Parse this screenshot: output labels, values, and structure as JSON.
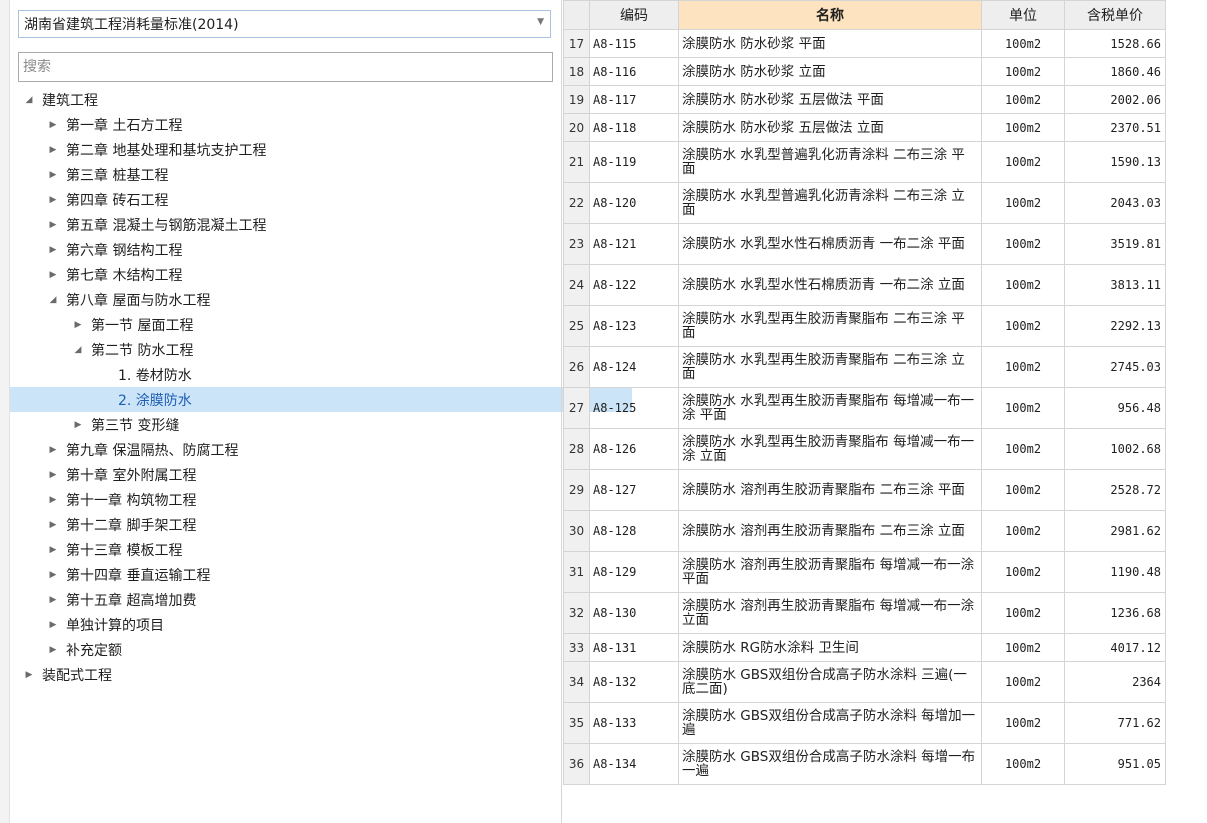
{
  "selector": {
    "value": "湖南省建筑工程消耗量标准(2014)"
  },
  "search": {
    "placeholder": "搜索"
  },
  "tree": [
    {
      "label": "建筑工程",
      "level": 0,
      "toggle": "open"
    },
    {
      "label": "第一章 土石方工程",
      "level": 1,
      "toggle": "closed"
    },
    {
      "label": "第二章 地基处理和基坑支护工程",
      "level": 1,
      "toggle": "closed"
    },
    {
      "label": "第三章 桩基工程",
      "level": 1,
      "toggle": "closed"
    },
    {
      "label": "第四章 砖石工程",
      "level": 1,
      "toggle": "closed"
    },
    {
      "label": "第五章 混凝土与钢筋混凝土工程",
      "level": 1,
      "toggle": "closed"
    },
    {
      "label": "第六章 钢结构工程",
      "level": 1,
      "toggle": "closed"
    },
    {
      "label": "第七章 木结构工程",
      "level": 1,
      "toggle": "closed"
    },
    {
      "label": "第八章 屋面与防水工程",
      "level": 1,
      "toggle": "open"
    },
    {
      "label": "第一节 屋面工程",
      "level": 2,
      "toggle": "closed"
    },
    {
      "label": "第二节 防水工程",
      "level": 2,
      "toggle": "open"
    },
    {
      "label": "1. 卷材防水",
      "level": 3,
      "toggle": "none"
    },
    {
      "label": "2. 涂膜防水",
      "level": 3,
      "toggle": "none",
      "selected": true
    },
    {
      "label": "第三节 变形缝",
      "level": 2,
      "toggle": "closed"
    },
    {
      "label": "第九章 保温隔热、防腐工程",
      "level": 1,
      "toggle": "closed"
    },
    {
      "label": "第十章 室外附属工程",
      "level": 1,
      "toggle": "closed"
    },
    {
      "label": "第十一章 构筑物工程",
      "level": 1,
      "toggle": "closed"
    },
    {
      "label": "第十二章 脚手架工程",
      "level": 1,
      "toggle": "closed"
    },
    {
      "label": "第十三章 模板工程",
      "level": 1,
      "toggle": "closed"
    },
    {
      "label": "第十四章 垂直运输工程",
      "level": 1,
      "toggle": "closed"
    },
    {
      "label": "第十五章 超高增加费",
      "level": 1,
      "toggle": "closed"
    },
    {
      "label": "单独计算的项目",
      "level": 1,
      "toggle": "closed"
    },
    {
      "label": "补充定额",
      "level": 1,
      "toggle": "closed"
    },
    {
      "label": "装配式工程",
      "level": 0,
      "toggle": "closed"
    }
  ],
  "grid": {
    "columns": [
      "编码",
      "名称",
      "单位",
      "含税单价"
    ],
    "rows": [
      {
        "no": "17",
        "code": "A8-115",
        "name": "涂膜防水 防水砂浆 平面",
        "unit": "100m2",
        "price": "1528.66"
      },
      {
        "no": "18",
        "code": "A8-116",
        "name": "涂膜防水 防水砂浆 立面",
        "unit": "100m2",
        "price": "1860.46"
      },
      {
        "no": "19",
        "code": "A8-117",
        "name": "涂膜防水 防水砂浆 五层做法 平面",
        "unit": "100m2",
        "price": "2002.06"
      },
      {
        "no": "20",
        "code": "A8-118",
        "name": "涂膜防水 防水砂浆 五层做法 立面",
        "unit": "100m2",
        "price": "2370.51"
      },
      {
        "no": "21",
        "code": "A8-119",
        "name": "涂膜防水 水乳型普遍乳化沥青涂料 二布三涂 平面",
        "unit": "100m2",
        "price": "1590.13"
      },
      {
        "no": "22",
        "code": "A8-120",
        "name": "涂膜防水 水乳型普遍乳化沥青涂料 二布三涂 立面",
        "unit": "100m2",
        "price": "2043.03"
      },
      {
        "no": "23",
        "code": "A8-121",
        "name": "涂膜防水 水乳型水性石棉质沥青 一布二涂 平面",
        "unit": "100m2",
        "price": "3519.81"
      },
      {
        "no": "24",
        "code": "A8-122",
        "name": "涂膜防水 水乳型水性石棉质沥青 一布二涂 立面",
        "unit": "100m2",
        "price": "3813.11"
      },
      {
        "no": "25",
        "code": "A8-123",
        "name": "涂膜防水 水乳型再生胶沥青聚脂布 二布三涂 平面",
        "unit": "100m2",
        "price": "2292.13"
      },
      {
        "no": "26",
        "code": "A8-124",
        "name": "涂膜防水 水乳型再生胶沥青聚脂布 二布三涂 立面",
        "unit": "100m2",
        "price": "2745.03"
      },
      {
        "no": "27",
        "code": "A8-125",
        "name": "涂膜防水 水乳型再生胶沥青聚脂布 每增减一布一涂 平面",
        "unit": "100m2",
        "price": "956.48"
      },
      {
        "no": "28",
        "code": "A8-126",
        "name": "涂膜防水 水乳型再生胶沥青聚脂布 每增减一布一涂 立面",
        "unit": "100m2",
        "price": "1002.68"
      },
      {
        "no": "29",
        "code": "A8-127",
        "name": "涂膜防水 溶剂再生胶沥青聚脂布 二布三涂 平面",
        "unit": "100m2",
        "price": "2528.72"
      },
      {
        "no": "30",
        "code": "A8-128",
        "name": "涂膜防水 溶剂再生胶沥青聚脂布 二布三涂 立面",
        "unit": "100m2",
        "price": "2981.62"
      },
      {
        "no": "31",
        "code": "A8-129",
        "name": "涂膜防水 溶剂再生胶沥青聚脂布 每增减一布一涂 平面",
        "unit": "100m2",
        "price": "1190.48"
      },
      {
        "no": "32",
        "code": "A8-130",
        "name": "涂膜防水 溶剂再生胶沥青聚脂布 每增减一布一涂 立面",
        "unit": "100m2",
        "price": "1236.68"
      },
      {
        "no": "33",
        "code": "A8-131",
        "name": "涂膜防水 RG防水涂料 卫生间",
        "unit": "100m2",
        "price": "4017.12"
      },
      {
        "no": "34",
        "code": "A8-132",
        "name": "涂膜防水 GBS双组份合成高子防水涂料 三遍(一底二面)",
        "unit": "100m2",
        "price": "2364"
      },
      {
        "no": "35",
        "code": "A8-133",
        "name": "涂膜防水 GBS双组份合成高子防水涂料 每增加一遍",
        "unit": "100m2",
        "price": "771.62"
      },
      {
        "no": "36",
        "code": "A8-134",
        "name": "涂膜防水 GBS双组份合成高子防水涂料 每增一布一遍",
        "unit": "100m2",
        "price": "951.05"
      }
    ]
  }
}
